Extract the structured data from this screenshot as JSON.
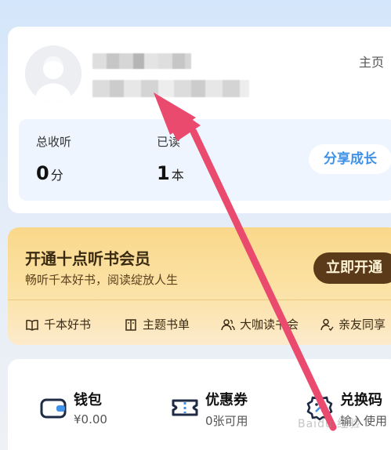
{
  "profile": {
    "homepage_label": "主页",
    "stats": [
      {
        "label": "总收听",
        "value": "0",
        "unit": "分"
      },
      {
        "label": "已读",
        "value": "1",
        "unit": "本"
      }
    ],
    "share_button": "分享成长"
  },
  "membership": {
    "title": "开通十点听书会员",
    "subtitle": "畅听千本好书，阅读绽放人生",
    "cta_button": "立即开通",
    "features": [
      "千本好书",
      "主题书单",
      "大咖读书会",
      "亲友同享"
    ]
  },
  "wallet": {
    "items": [
      {
        "title": "钱包",
        "subtitle": "¥0.00",
        "icon": "wallet-icon"
      },
      {
        "title": "优惠券",
        "subtitle": "0张可用",
        "icon": "coupon-icon"
      },
      {
        "title": "兑换码",
        "subtitle": "输入使用",
        "icon": "exchange-code-icon"
      }
    ]
  },
  "watermark": "Baidu 经验",
  "colors": {
    "share_text": "#3f92e8",
    "vip_button": "#5a3a18",
    "arrow": "#e94a6d"
  }
}
